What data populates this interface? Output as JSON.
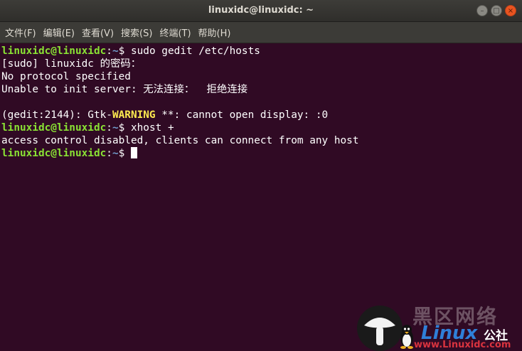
{
  "window": {
    "title": "linuxidc@linuxidc: ~",
    "minimize_glyph": "–",
    "maximize_glyph": "□",
    "close_glyph": "×"
  },
  "menu": {
    "items": [
      "文件(F)",
      "编辑(E)",
      "查看(V)",
      "搜索(S)",
      "终端(T)",
      "帮助(H)"
    ]
  },
  "terminal": {
    "prompt_user": "linuxidc@linuxidc",
    "prompt_path": "~",
    "cmd1": "sudo gedit /etc/hosts",
    "out1": "[sudo] linuxidc 的密码：",
    "out2": "No protocol specified",
    "out3": "Unable to init server: 无法连接：  拒绝连接",
    "out4": "",
    "out5_pre": "(gedit:2144): Gtk-",
    "out5_warn": "WARNING",
    "out5_post": " **: cannot open display: :0",
    "cmd2": "xhost +",
    "out6": "access control disabled, clients can connect from any host",
    "cmd3": ""
  },
  "watermark": {
    "cn_text": "黑区网络",
    "brand": "Linux",
    "brand_suffix": "公社",
    "url": "www.Linuxidc.com"
  },
  "colors": {
    "terminal_bg": "#300a24",
    "prompt_green": "#8ae234",
    "path_blue": "#729fcf",
    "warning_yellow": "#fce94f",
    "close_orange": "#e95420"
  }
}
